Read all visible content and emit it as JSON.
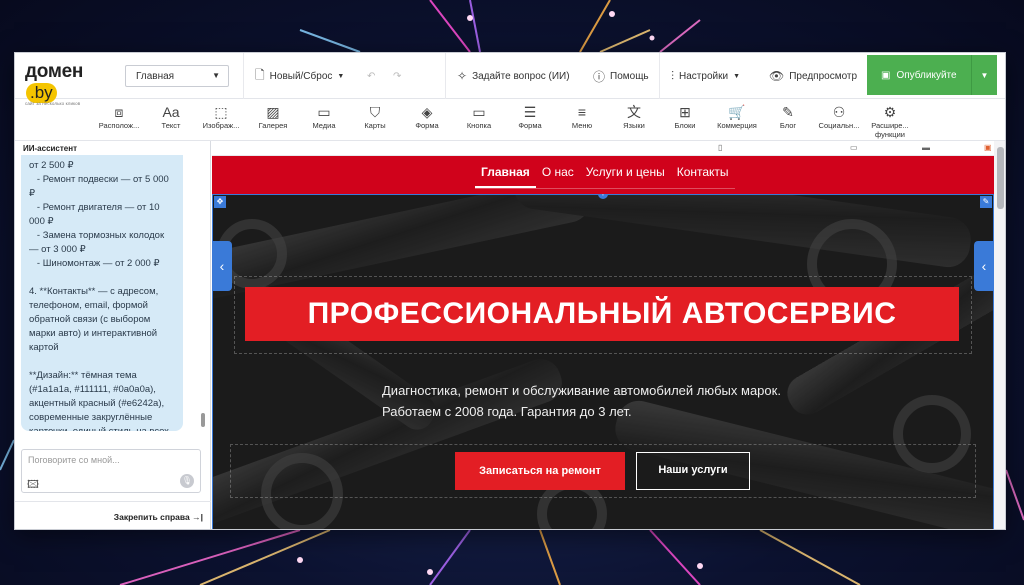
{
  "logo": {
    "main": "домен",
    "by": ".by",
    "sub": "сайт за несколько кликов"
  },
  "header": {
    "page_select": "Главная",
    "new_reset": "Новый/Сброс",
    "ask_ai": "Задайте вопрос (ИИ)",
    "help": "Помощь",
    "settings": "Настройки",
    "preview": "Предпросмотр",
    "publish": "Опубликуйте"
  },
  "toolbar": {
    "items": [
      {
        "label": "Располож...",
        "icon": "layout-icon"
      },
      {
        "label": "Текст",
        "icon": "text-icon"
      },
      {
        "label": "Изображ...",
        "icon": "image-icon"
      },
      {
        "label": "Галерея",
        "icon": "gallery-icon"
      },
      {
        "label": "Медиа",
        "icon": "video-icon"
      },
      {
        "label": "Карты",
        "icon": "map-icon"
      },
      {
        "label": "Форма",
        "icon": "shapes-icon"
      },
      {
        "label": "Кнопка",
        "icon": "button-icon"
      },
      {
        "label": "Форма",
        "icon": "form-icon"
      },
      {
        "label": "Меню",
        "icon": "menu-icon"
      },
      {
        "label": "Языки",
        "icon": "translate-icon"
      },
      {
        "label": "Блоки",
        "icon": "blocks-icon"
      },
      {
        "label": "Коммерция",
        "icon": "cart-icon"
      },
      {
        "label": "Блог",
        "icon": "pen-icon"
      },
      {
        "label": "Социальн...",
        "icon": "social-icon"
      },
      {
        "label": "Расшире... функции",
        "icon": "extensions-icon"
      }
    ]
  },
  "left_panel": {
    "title": "ИИ-ассистент",
    "message": "от 2 500 ₽\n   - Ремонт подвески — от 5 000 ₽\n   - Ремонт двигателя — от 10 000 ₽\n   - Замена тормозных колодок — от 3 000 ₽\n   - Шиномонтаж — от 2 000 ₽\n\n4. **Контакты** — с адресом, телефоном, email, формой обратной связи (с выбором марки авто) и интерактивной картой\n\n**Дизайн:** тёмная тема (#1a1a1a, #111111, #0a0a0a), акцентный красный (#e6242a), современные закруглённые карточки, единый стиль на всех страницах.",
    "input_placeholder": "Поговорите со мной...",
    "pin_label": "Закрепить справа"
  },
  "site": {
    "nav": [
      "Главная",
      "О нас",
      "Услуги и цены",
      "Контакты"
    ],
    "hero_title": "ПРОФЕССИОНАЛЬНЫЙ АВТОСЕРВИС",
    "hero_line1": "Диагностика, ремонт и обслуживание автомобилей любых марок.",
    "hero_line2": "Работаем с 2008 года. Гарантия до 3 лет.",
    "btn_primary": "Записаться на ремонт",
    "btn_secondary": "Наши услуги"
  },
  "colors": {
    "accent": "#d0021b",
    "button_red": "#e31e24",
    "publish_green": "#4caf50",
    "selection_blue": "#3a7ad8"
  }
}
